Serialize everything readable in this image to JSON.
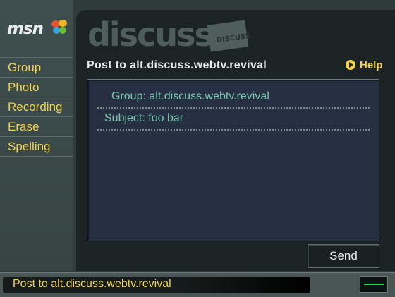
{
  "logo": {
    "text": "msn",
    "icon": "butterfly-icon"
  },
  "sidebar": {
    "items": [
      {
        "label": "Group"
      },
      {
        "label": "Photo"
      },
      {
        "label": "Recording"
      },
      {
        "label": "Erase"
      },
      {
        "label": "Spelling"
      }
    ]
  },
  "header": {
    "brand": "discuss",
    "badge_text": "DISCUSS",
    "title": "Post to alt.discuss.webtv.revival",
    "help_label": "Help",
    "help_icon": "play-circle-icon"
  },
  "form": {
    "group_label": "Group:",
    "group_value": "alt.discuss.webtv.revival",
    "subject_label": "Subject:",
    "subject_value": "foo bar"
  },
  "actions": {
    "send_label": "Send"
  },
  "status": {
    "text": "Post to alt.discuss.webtv.revival",
    "indicator_icon": "signal-indicator-icon"
  },
  "colors": {
    "accent": "#f2d14b",
    "field_text": "#79c5b1",
    "panel": "#263042",
    "signal": "#29d24d"
  }
}
